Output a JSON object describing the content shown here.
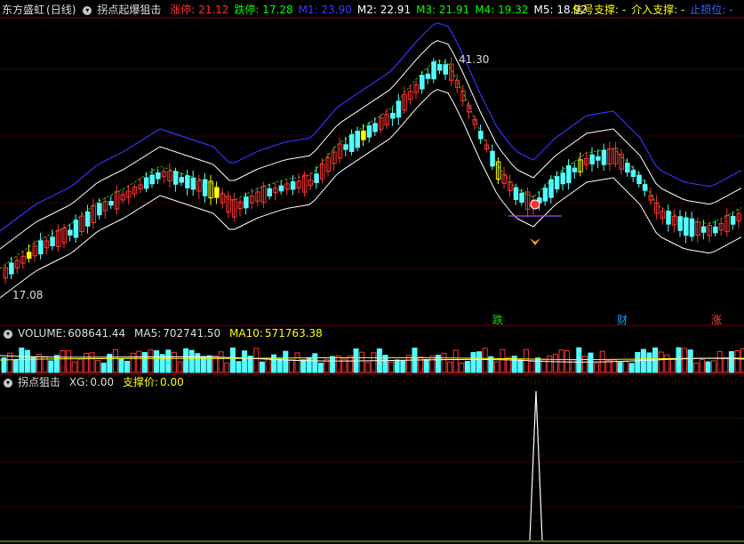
{
  "header": {
    "stock_name": "东方盛虹",
    "period": "(日线)",
    "indicator": "拐点起爆狙击",
    "items": [
      {
        "label": "涨停:",
        "value": "21.12",
        "color": "#ff3333"
      },
      {
        "label": "跌停:",
        "value": "17.28",
        "color": "#00ff00"
      },
      {
        "label": "M1:",
        "value": "23.90",
        "color": "#3a3aff"
      },
      {
        "label": "M2:",
        "value": "22.91",
        "color": "#ffffff"
      },
      {
        "label": "M3:",
        "value": "21.91",
        "color": "#00ff00"
      },
      {
        "label": "M4:",
        "value": "19.32",
        "color": "#00ff00"
      },
      {
        "label": "M5:",
        "value": "18.92",
        "color": "#ffffff"
      }
    ],
    "right_items": [
      {
        "label": "信号支撑:",
        "value": "-",
        "color": "#ffff00"
      },
      {
        "label": "介入支撑:",
        "value": "-",
        "color": "#ffff00"
      },
      {
        "label": "止损位:",
        "value": "-",
        "color": "#3a6aff"
      }
    ]
  },
  "main_chart": {
    "high_label": "41.30",
    "low_label": "17.08",
    "signal_tags": [
      {
        "text": "跌",
        "color": "#00e000"
      },
      {
        "text": "财",
        "color": "#00aaff"
      },
      {
        "text": "涨",
        "color": "#ff4040"
      }
    ]
  },
  "volume_panel": {
    "title": "VOLUME:",
    "value": "608641.44",
    "ma5_label": "MA5:",
    "ma5_value": "702741.50",
    "ma10_label": "MA10:",
    "ma10_value": "571763.38"
  },
  "indicator_panel": {
    "title": "拐点狙击",
    "xg_label": "XG:",
    "xg_value": "0.00",
    "support_label": "支撑价:",
    "support_value": "0.00"
  },
  "colors": {
    "up": "#ff3333",
    "down": "#54ffff",
    "signal": "#ffff00",
    "grid": "#800000",
    "upper_band": "#3333ff"
  }
}
